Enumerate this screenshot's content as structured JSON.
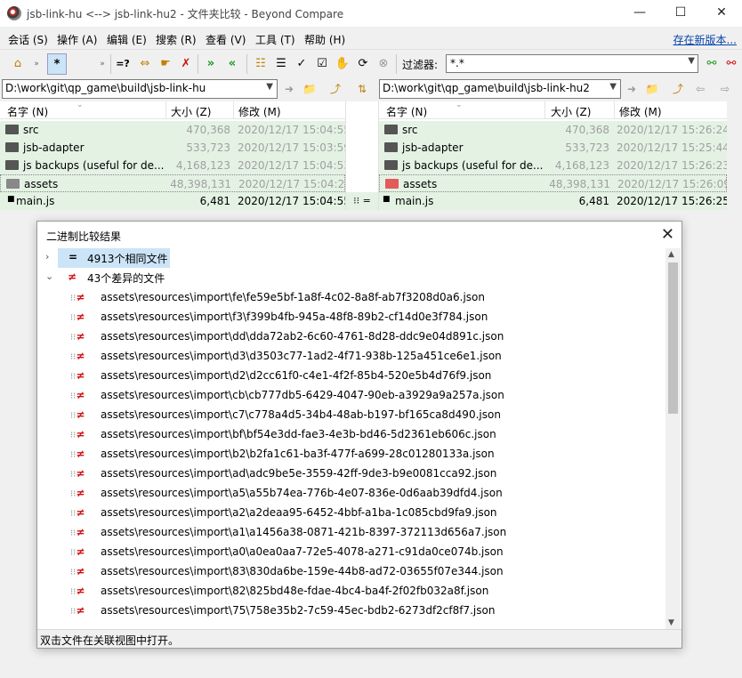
{
  "window": {
    "title": "jsb-link-hu <--> jsb-link-hu2 - 文件夹比较 - Beyond Compare",
    "minimize": "—",
    "maximize": "☐",
    "close": "✕"
  },
  "menu": {
    "items": [
      "会话 (S)",
      "操作 (A)",
      "编辑 (E)",
      "搜索 (R)",
      "查看 (V)",
      "工具 (T)",
      "帮助 (H)"
    ],
    "new_version_link": "存在新版本..."
  },
  "toolbar": {
    "filter_label": "过滤器:",
    "filter_value": "*.*",
    "star": "*",
    "neq_label": "=?"
  },
  "left": {
    "path": "D:\\work\\git\\qp_game\\build\\jsb-link-hu",
    "headers": {
      "name": "名字 (N)",
      "size": "大小 (Z)",
      "modified": "修改 (M)"
    },
    "rows": [
      {
        "name": "src",
        "size": "470,368",
        "date": "2020/12/17 15:04:55",
        "type": "folder"
      },
      {
        "name": "jsb-adapter",
        "size": "533,723",
        "date": "2020/12/17 15:03:59",
        "type": "folder"
      },
      {
        "name": "js backups (useful for de...",
        "size": "4,168,123",
        "date": "2020/12/17 15:04:53",
        "type": "folder"
      },
      {
        "name": "assets",
        "size": "48,398,131",
        "date": "2020/12/17 15:04:24",
        "type": "folder"
      },
      {
        "name": "main.js",
        "size": "6,481",
        "date": "2020/12/17 15:04:55",
        "type": "file"
      }
    ]
  },
  "right": {
    "path": "D:\\work\\git\\qp_game\\build\\jsb-link-hu2",
    "headers": {
      "name": "名字 (N)",
      "size": "大小 (Z)",
      "modified": "修改 (M)"
    },
    "rows": [
      {
        "name": "src",
        "size": "470,368",
        "date": "2020/12/17 15:26:24",
        "type": "folder"
      },
      {
        "name": "jsb-adapter",
        "size": "533,723",
        "date": "2020/12/17 15:25:44",
        "type": "folder"
      },
      {
        "name": "js backups (useful for de...",
        "size": "4,168,123",
        "date": "2020/12/17 15:26:23",
        "type": "folder"
      },
      {
        "name": "assets",
        "size": "48,398,131",
        "date": "2020/12/17 15:26:09",
        "type": "folder"
      },
      {
        "name": "main.js",
        "size": "6,481",
        "date": "2020/12/17 15:26:25",
        "type": "file"
      }
    ]
  },
  "dialog": {
    "title": "二进制比较结果",
    "same_node": "4913个相同文件",
    "diff_node": "43个差异的文件",
    "files": [
      "assets\\resources\\import\\fe\\fe59e5bf-1a8f-4c02-8a8f-ab7f3208d0a6.json",
      "assets\\resources\\import\\f3\\f399b4fb-945a-48f8-89b2-cf14d0e3f784.json",
      "assets\\resources\\import\\dd\\dda72ab2-6c60-4761-8d28-ddc9e04d891c.json",
      "assets\\resources\\import\\d3\\d3503c77-1ad2-4f71-938b-125a451ce6e1.json",
      "assets\\resources\\import\\d2\\d2cc61f0-c4e1-4f2f-85b4-520e5b4d76f9.json",
      "assets\\resources\\import\\cb\\cb777db5-6429-4047-90eb-a3929a9a257a.json",
      "assets\\resources\\import\\c7\\c778a4d5-34b4-48ab-b197-bf165ca8d490.json",
      "assets\\resources\\import\\bf\\bf54e3dd-fae3-4e3b-bd46-5d2361eb606c.json",
      "assets\\resources\\import\\b2\\b2fa1c61-ba3f-477f-a699-28c01280133a.json",
      "assets\\resources\\import\\ad\\adc9be5e-3559-42ff-9de3-b9e0081cca92.json",
      "assets\\resources\\import\\a5\\a55b74ea-776b-4e07-836e-0d6aab39dfd4.json",
      "assets\\resources\\import\\a2\\a2deaa95-6452-4bbf-a1ba-1c085cbd9fa9.json",
      "assets\\resources\\import\\a1\\a1456a38-0871-421b-8397-372113d656a7.json",
      "assets\\resources\\import\\a0\\a0ea0aa7-72e5-4078-a271-c91da0ce074b.json",
      "assets\\resources\\import\\83\\830da6be-159e-44b8-ad72-03655f07e344.json",
      "assets\\resources\\import\\82\\825bd48e-fdae-4bc4-ba4f-2f02fb032a8f.json",
      "assets\\resources\\import\\75\\758e35b2-7c59-45ec-bdb2-6273df2cf8f7.json"
    ],
    "status": "双击文件在关联视图中打开。"
  }
}
